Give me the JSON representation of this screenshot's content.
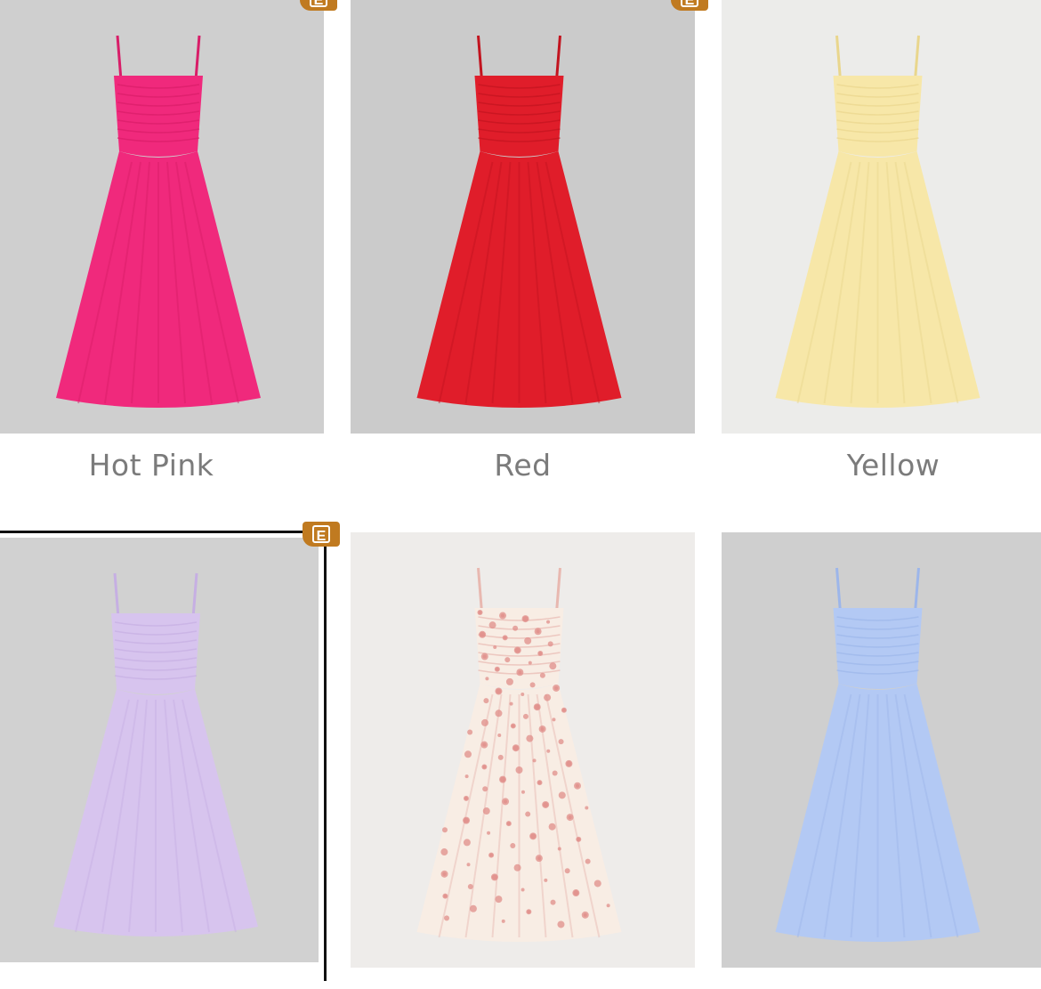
{
  "colors": [
    {
      "label": "Hot Pink",
      "dress": "#f0297c",
      "shade": "#d81d68",
      "bg": "#cfcfcf",
      "pattern": "solid"
    },
    {
      "label": "Red",
      "dress": "#e01d2a",
      "shade": "#c2141f",
      "bg": "#cbcbcb",
      "pattern": "solid"
    },
    {
      "label": "Yellow",
      "dress": "#f7e7a8",
      "shade": "#e9d68d",
      "bg": "#ececea",
      "pattern": "solid"
    },
    {
      "label": "",
      "dress": "#d7c4ee",
      "shade": "#c6afe3",
      "bg": "#d1d1d1",
      "pattern": "solid"
    },
    {
      "label": "",
      "dress": "#f8ede4",
      "shade": "#e8b8b0",
      "bg": "#eeecea",
      "pattern": "floral"
    },
    {
      "label": "",
      "dress": "#b3c9f4",
      "shade": "#9db6ea",
      "bg": "#cfcfcf",
      "pattern": "solid"
    }
  ],
  "badge_letter": "E",
  "badge_color": "#c07a20",
  "selected_index": 3
}
